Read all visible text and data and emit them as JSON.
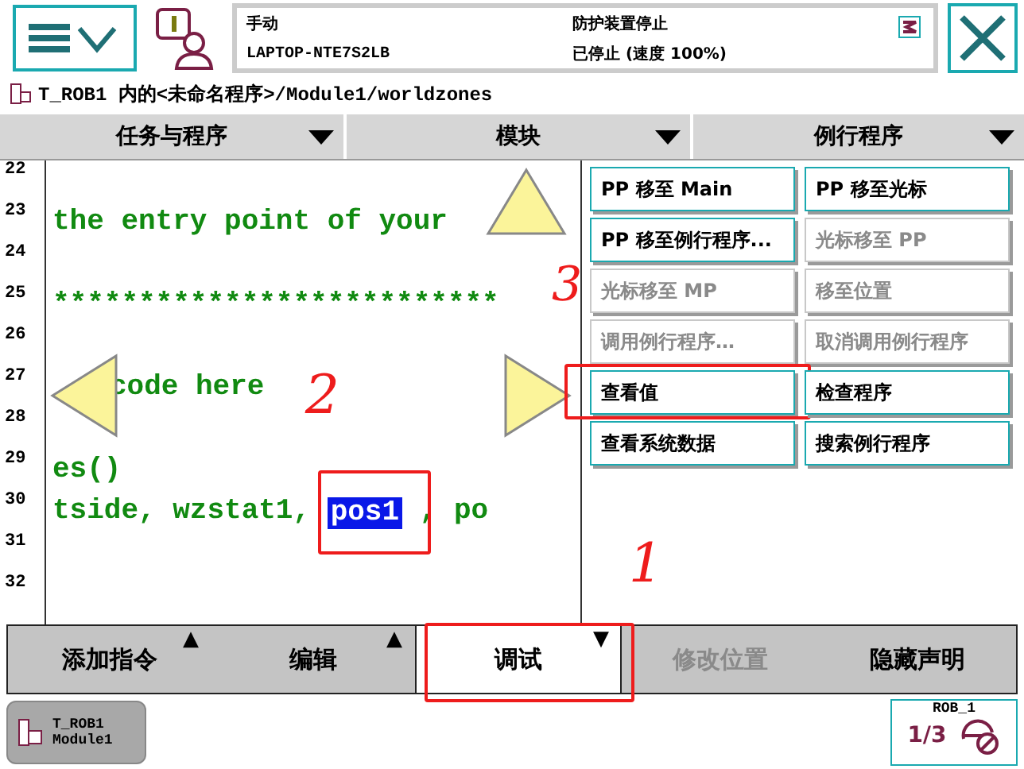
{
  "header": {
    "mode": "手动",
    "host": "LAPTOP-NTE7S2LB",
    "safety": "防护装置停止",
    "status": "已停止 (速度 100%)"
  },
  "path": "T_ROB1 内的<未命名程序>/Module1/worldzones",
  "selectors": [
    "任务与程序",
    "模块",
    "例行程序"
  ],
  "code_lines": [
    {
      "number": "22"
    },
    {
      "number": "23",
      "text": "the entry point of your"
    },
    {
      "number": "24"
    },
    {
      "number": "25",
      "text": "**************************"
    },
    {
      "number": "26"
    },
    {
      "number": "27",
      "text": "code here"
    },
    {
      "number": "28"
    },
    {
      "number": "29",
      "text": "es()"
    },
    {
      "number": "30",
      "text": "tside, wzstat1, ",
      "selected_text": "pos1",
      "after": " , po",
      "annotated": true,
      "mark": "2"
    },
    {
      "number": "31"
    },
    {
      "number": "32"
    }
  ],
  "debug_menu": [
    {
      "label": "PP 移至 Main",
      "disabled": false,
      "annotated": false
    },
    {
      "label": "PP 移至光标",
      "disabled": false,
      "annotated": false
    },
    {
      "label": "PP 移至例行程序...",
      "disabled": false,
      "annotated": false
    },
    {
      "label": "光标移至 PP",
      "disabled": true,
      "annotated": false
    },
    {
      "label": "光标移至 MP",
      "disabled": true,
      "annotated": false,
      "mark": "3"
    },
    {
      "label": "移至位置",
      "disabled": true,
      "annotated": false
    },
    {
      "label": "调用例行程序…",
      "disabled": true,
      "annotated": false
    },
    {
      "label": "取消调用例行程序",
      "disabled": true,
      "annotated": false
    },
    {
      "label": "查看值",
      "disabled": false,
      "annotated": true
    },
    {
      "label": "检查程序",
      "disabled": false,
      "annotated": false
    },
    {
      "label": "查看系统数据",
      "disabled": false,
      "annotated": false
    },
    {
      "label": "搜索例行程序",
      "disabled": false,
      "annotated": false
    }
  ],
  "toolbar": [
    {
      "label": "添加指令",
      "caret": "▲",
      "selected": false,
      "disabled": false,
      "annotated": false
    },
    {
      "label": "编辑",
      "caret": "▲",
      "selected": false,
      "disabled": false,
      "annotated": false
    },
    {
      "label": "调试",
      "caret": "▼",
      "selected": true,
      "disabled": false,
      "annotated": true,
      "mark": "1"
    },
    {
      "label": "修改位置",
      "selected": false,
      "disabled": true,
      "annotated": false
    },
    {
      "label": "隐藏声明",
      "selected": false,
      "disabled": false,
      "annotated": false
    }
  ],
  "task_button": {
    "task": "T_ROB1",
    "module": "Module1"
  },
  "robot": {
    "name": "ROB_1",
    "speed": "1/3"
  }
}
